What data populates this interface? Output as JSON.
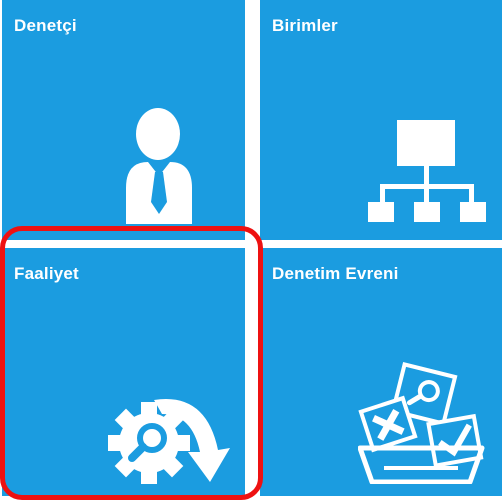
{
  "tiles": {
    "denetci": {
      "label": "Denetçi",
      "icon": "auditor-person-icon"
    },
    "birimler": {
      "label": "Birimler",
      "icon": "org-chart-icon"
    },
    "faaliyet": {
      "label": "Faaliyet",
      "icon": "gear-search-icon"
    },
    "denetim_evreni": {
      "label": "Denetim Evreni",
      "icon": "basket-checklist-icon"
    }
  },
  "colors": {
    "tile_bg": "#1b9ce0",
    "highlight": "#ee1111",
    "icon": "#ffffff"
  },
  "highlighted_tile": "faaliyet"
}
